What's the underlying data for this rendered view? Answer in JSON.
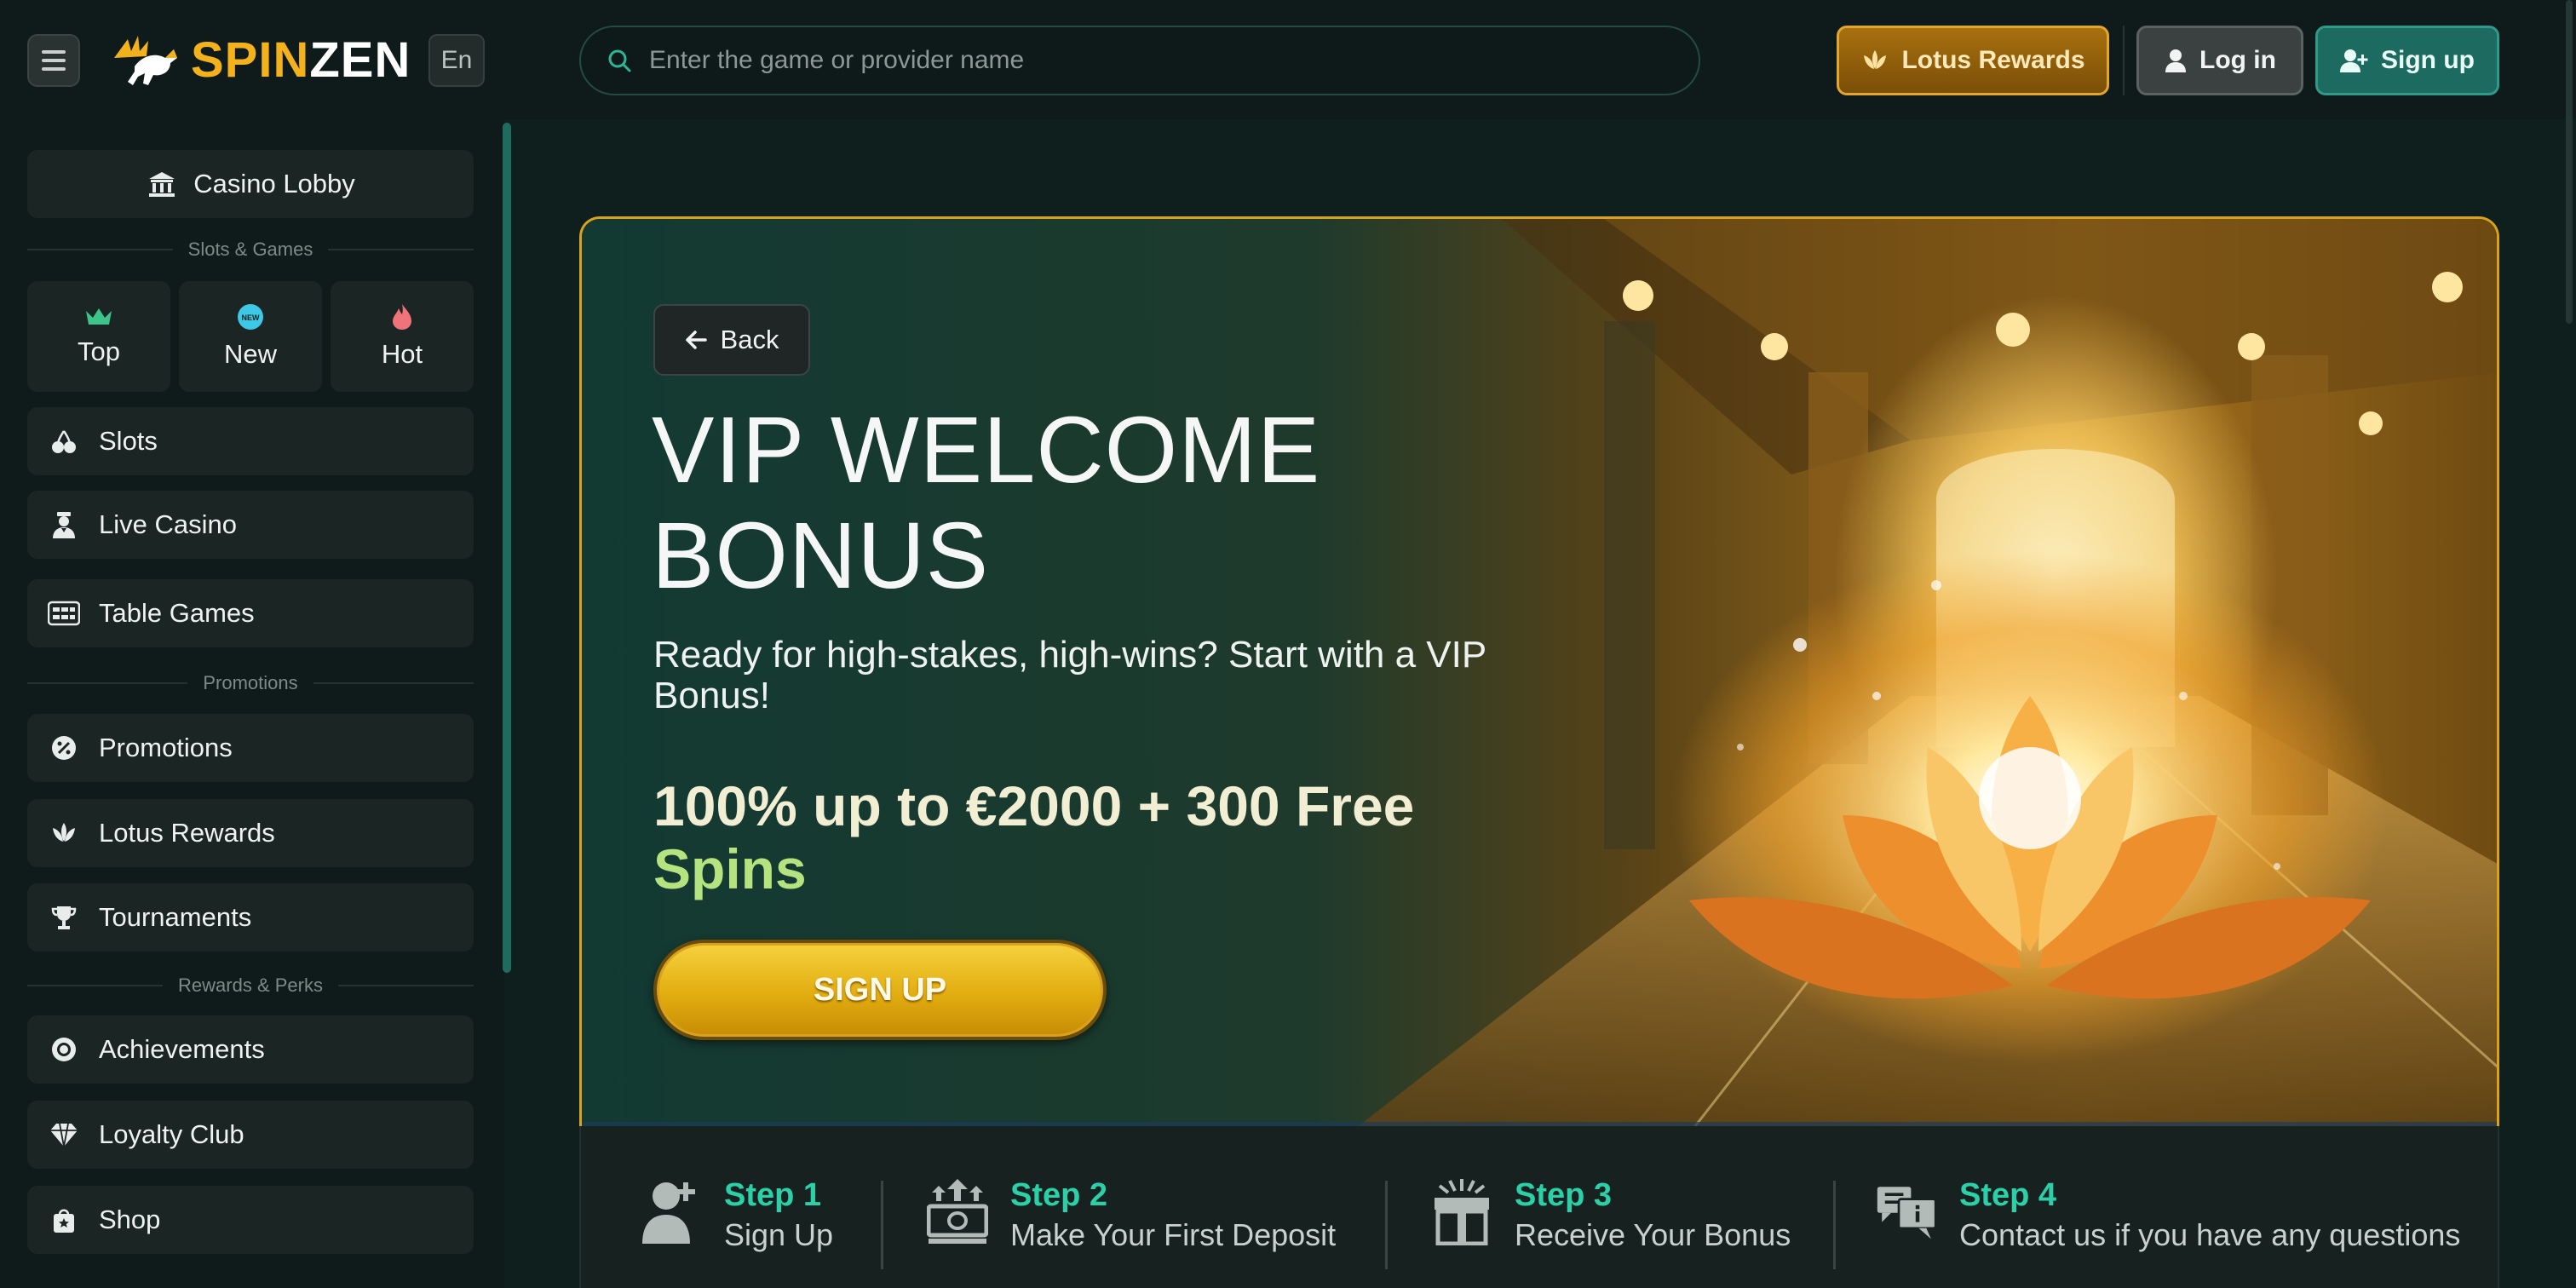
{
  "header": {
    "logo_spin": "SPIN",
    "logo_zen": "ZEN",
    "language": "En",
    "search_placeholder": "Enter the game or provider name",
    "rewards_label": "Lotus Rewards",
    "login_label": "Log in",
    "signup_label": "Sign up"
  },
  "sidebar": {
    "casino_lobby": "Casino Lobby",
    "section_slots": "Slots & Games",
    "tiles": [
      {
        "label": "Top",
        "icon": "crown-icon"
      },
      {
        "label": "New",
        "icon": "new-badge-icon"
      },
      {
        "label": "Hot",
        "icon": "flame-icon"
      }
    ],
    "games": [
      {
        "label": "Slots",
        "icon": "cherries-icon"
      },
      {
        "label": "Live Casino",
        "icon": "dealer-icon"
      },
      {
        "label": "Table Games",
        "icon": "table-games-icon"
      }
    ],
    "section_promotions": "Promotions",
    "promotions": [
      {
        "label": "Promotions",
        "icon": "percent-badge-icon"
      },
      {
        "label": "Lotus Rewards",
        "icon": "lotus-icon"
      },
      {
        "label": "Tournaments",
        "icon": "trophy-icon"
      }
    ],
    "section_rewards": "Rewards & Perks",
    "rewards": [
      {
        "label": "Achievements",
        "icon": "medal-icon"
      },
      {
        "label": "Loyalty Club",
        "icon": "diamond-icon"
      },
      {
        "label": "Shop",
        "icon": "shopping-bag-icon"
      }
    ]
  },
  "hero": {
    "back_label": "Back",
    "title_line1": "VIP WELCOME",
    "title_line2": "BONUS",
    "subtitle": "Ready for high-stakes, high-wins? Start with a VIP Bonus!",
    "offer_part1": "100% up to €2000 + 300 Free",
    "offer_part2": "Spins",
    "cta_label": "SIGN UP"
  },
  "steps": [
    {
      "num": "Step 1",
      "text": "Sign Up",
      "icon": "add-user-icon"
    },
    {
      "num": "Step 2",
      "text": "Make Your First Deposit",
      "icon": "deposit-icon"
    },
    {
      "num": "Step 3",
      "text": "Receive Your Bonus",
      "icon": "gift-icon"
    },
    {
      "num": "Step 4",
      "text": "Contact us if you have any questions",
      "icon": "support-chat-icon"
    }
  ],
  "colors": {
    "brand_gold": "#f3b21c",
    "accent_teal": "#2bd0a8",
    "offer_green": "#b5e37f",
    "page_bg": "#0f1f1d"
  }
}
